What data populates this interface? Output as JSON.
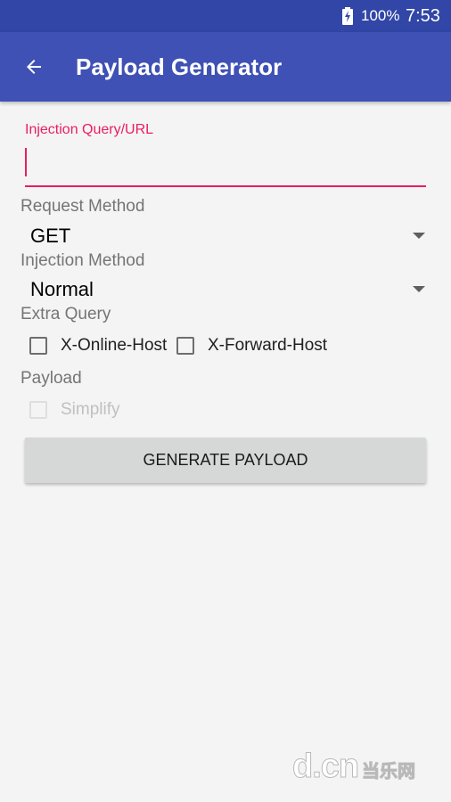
{
  "status_bar": {
    "battery_icon": "battery-charging-icon",
    "battery_percent": "100%",
    "time": "7:53"
  },
  "app_bar": {
    "back_icon": "arrow-back-icon",
    "title": "Payload Generator"
  },
  "form": {
    "injection_url": {
      "label": "Injection Query/URL",
      "value": ""
    },
    "request_method": {
      "label": "Request Method",
      "selected": "GET"
    },
    "injection_method": {
      "label": "Injection Method",
      "selected": "Normal"
    },
    "extra_query": {
      "label": "Extra Query",
      "options": [
        {
          "label": "X-Online-Host",
          "checked": false
        },
        {
          "label": "X-Forward-Host",
          "checked": false
        }
      ]
    },
    "payload": {
      "label": "Payload",
      "simplify": {
        "label": "Simplify",
        "checked": false,
        "enabled": false
      }
    },
    "generate_button": "GENERATE PAYLOAD"
  },
  "watermark": {
    "latin": "d.cn",
    "cjk": "当乐网"
  },
  "colors": {
    "status_bar": "#3146a6",
    "app_bar": "#3f51b5",
    "accent": "#e91e63",
    "background": "#f4f4f4",
    "button": "#d6d7d7"
  }
}
